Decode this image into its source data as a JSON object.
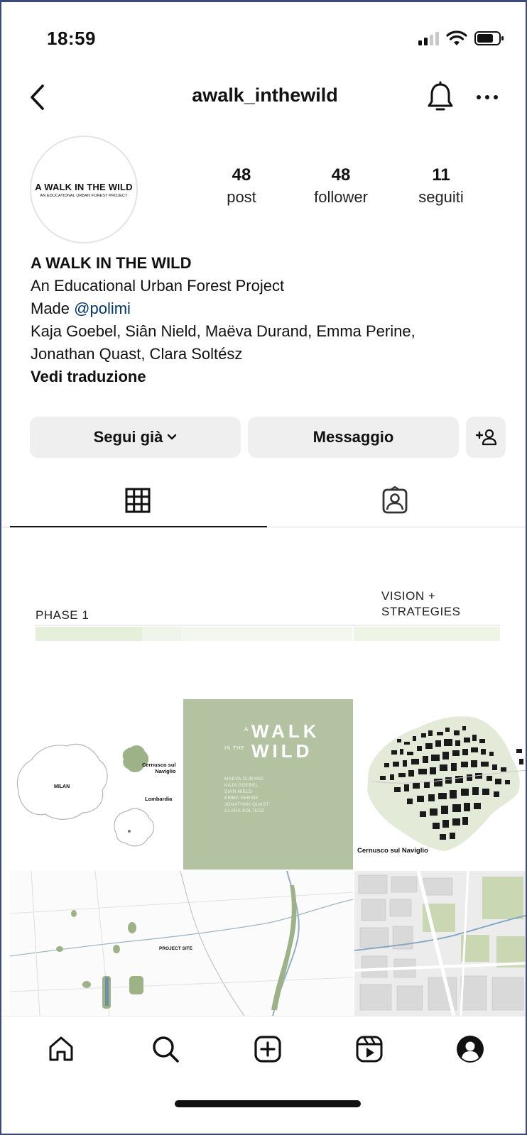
{
  "status_bar": {
    "time": "18:59",
    "icons": [
      "signal-icon",
      "wifi-icon",
      "battery-icon"
    ]
  },
  "header": {
    "username": "awalk_inthewild",
    "icons": [
      "back-icon",
      "bell-icon",
      "more-icon"
    ]
  },
  "profile": {
    "avatar_title": "A WALK IN THE WILD",
    "avatar_subtitle": "AN EDUCATIONAL URBAN FOREST PROJECT",
    "stats": [
      {
        "value": "48",
        "label": "post"
      },
      {
        "value": "48",
        "label": "follower"
      },
      {
        "value": "11",
        "label": "seguiti"
      }
    ],
    "bio": {
      "name": "A WALK IN THE WILD",
      "line1": "An Educational Urban Forest Project",
      "made_prefix": "Made ",
      "mention": "@polimi",
      "line3": "Kaja Goebel, Siân Nield, Maëva Durand, Emma Perine,",
      "line4": "Jonathan Quast, Clara Soltész",
      "translate": "Vedi traduzione"
    }
  },
  "actions": {
    "follow_label": "Segui già",
    "message_label": "Messaggio",
    "add_user_glyph": "+"
  },
  "tabs": [
    {
      "name": "grid",
      "icon": "grid-icon",
      "active": true
    },
    {
      "name": "tagged",
      "icon": "tagged-icon",
      "active": false
    }
  ],
  "posts": {
    "banner": {
      "phase_label": "PHASE 1",
      "vision_line1": "VISION +",
      "vision_line2": "STRATEGIES"
    },
    "map_labels": {
      "milan": "MILAN",
      "cernusco": "Cernusco sul",
      "naviglio": "Naviglio",
      "lombardia": "Lombardia"
    },
    "cover": {
      "title_a": "A",
      "title_walk": "WALK",
      "title_inthe": "IN THE",
      "title_wild": "WILD",
      "authors": [
        "MAEVA DURAND",
        "KAJA GOEBEL",
        "SIAN NIELD",
        "EMMA PERINE",
        "JONATHAN QUAST",
        "CLARA SOLTESZ"
      ]
    },
    "city_label": "Cernusco sul Naviglio",
    "project_site": "PROJECT SITE"
  },
  "bottom_nav": [
    "home-icon",
    "search-icon",
    "create-icon",
    "reels-icon",
    "profile-icon"
  ],
  "colors": {
    "button_bg": "#efefef",
    "mention": "#00376b",
    "cover_green": "#b3c3a1",
    "map_green": "#9db286"
  }
}
